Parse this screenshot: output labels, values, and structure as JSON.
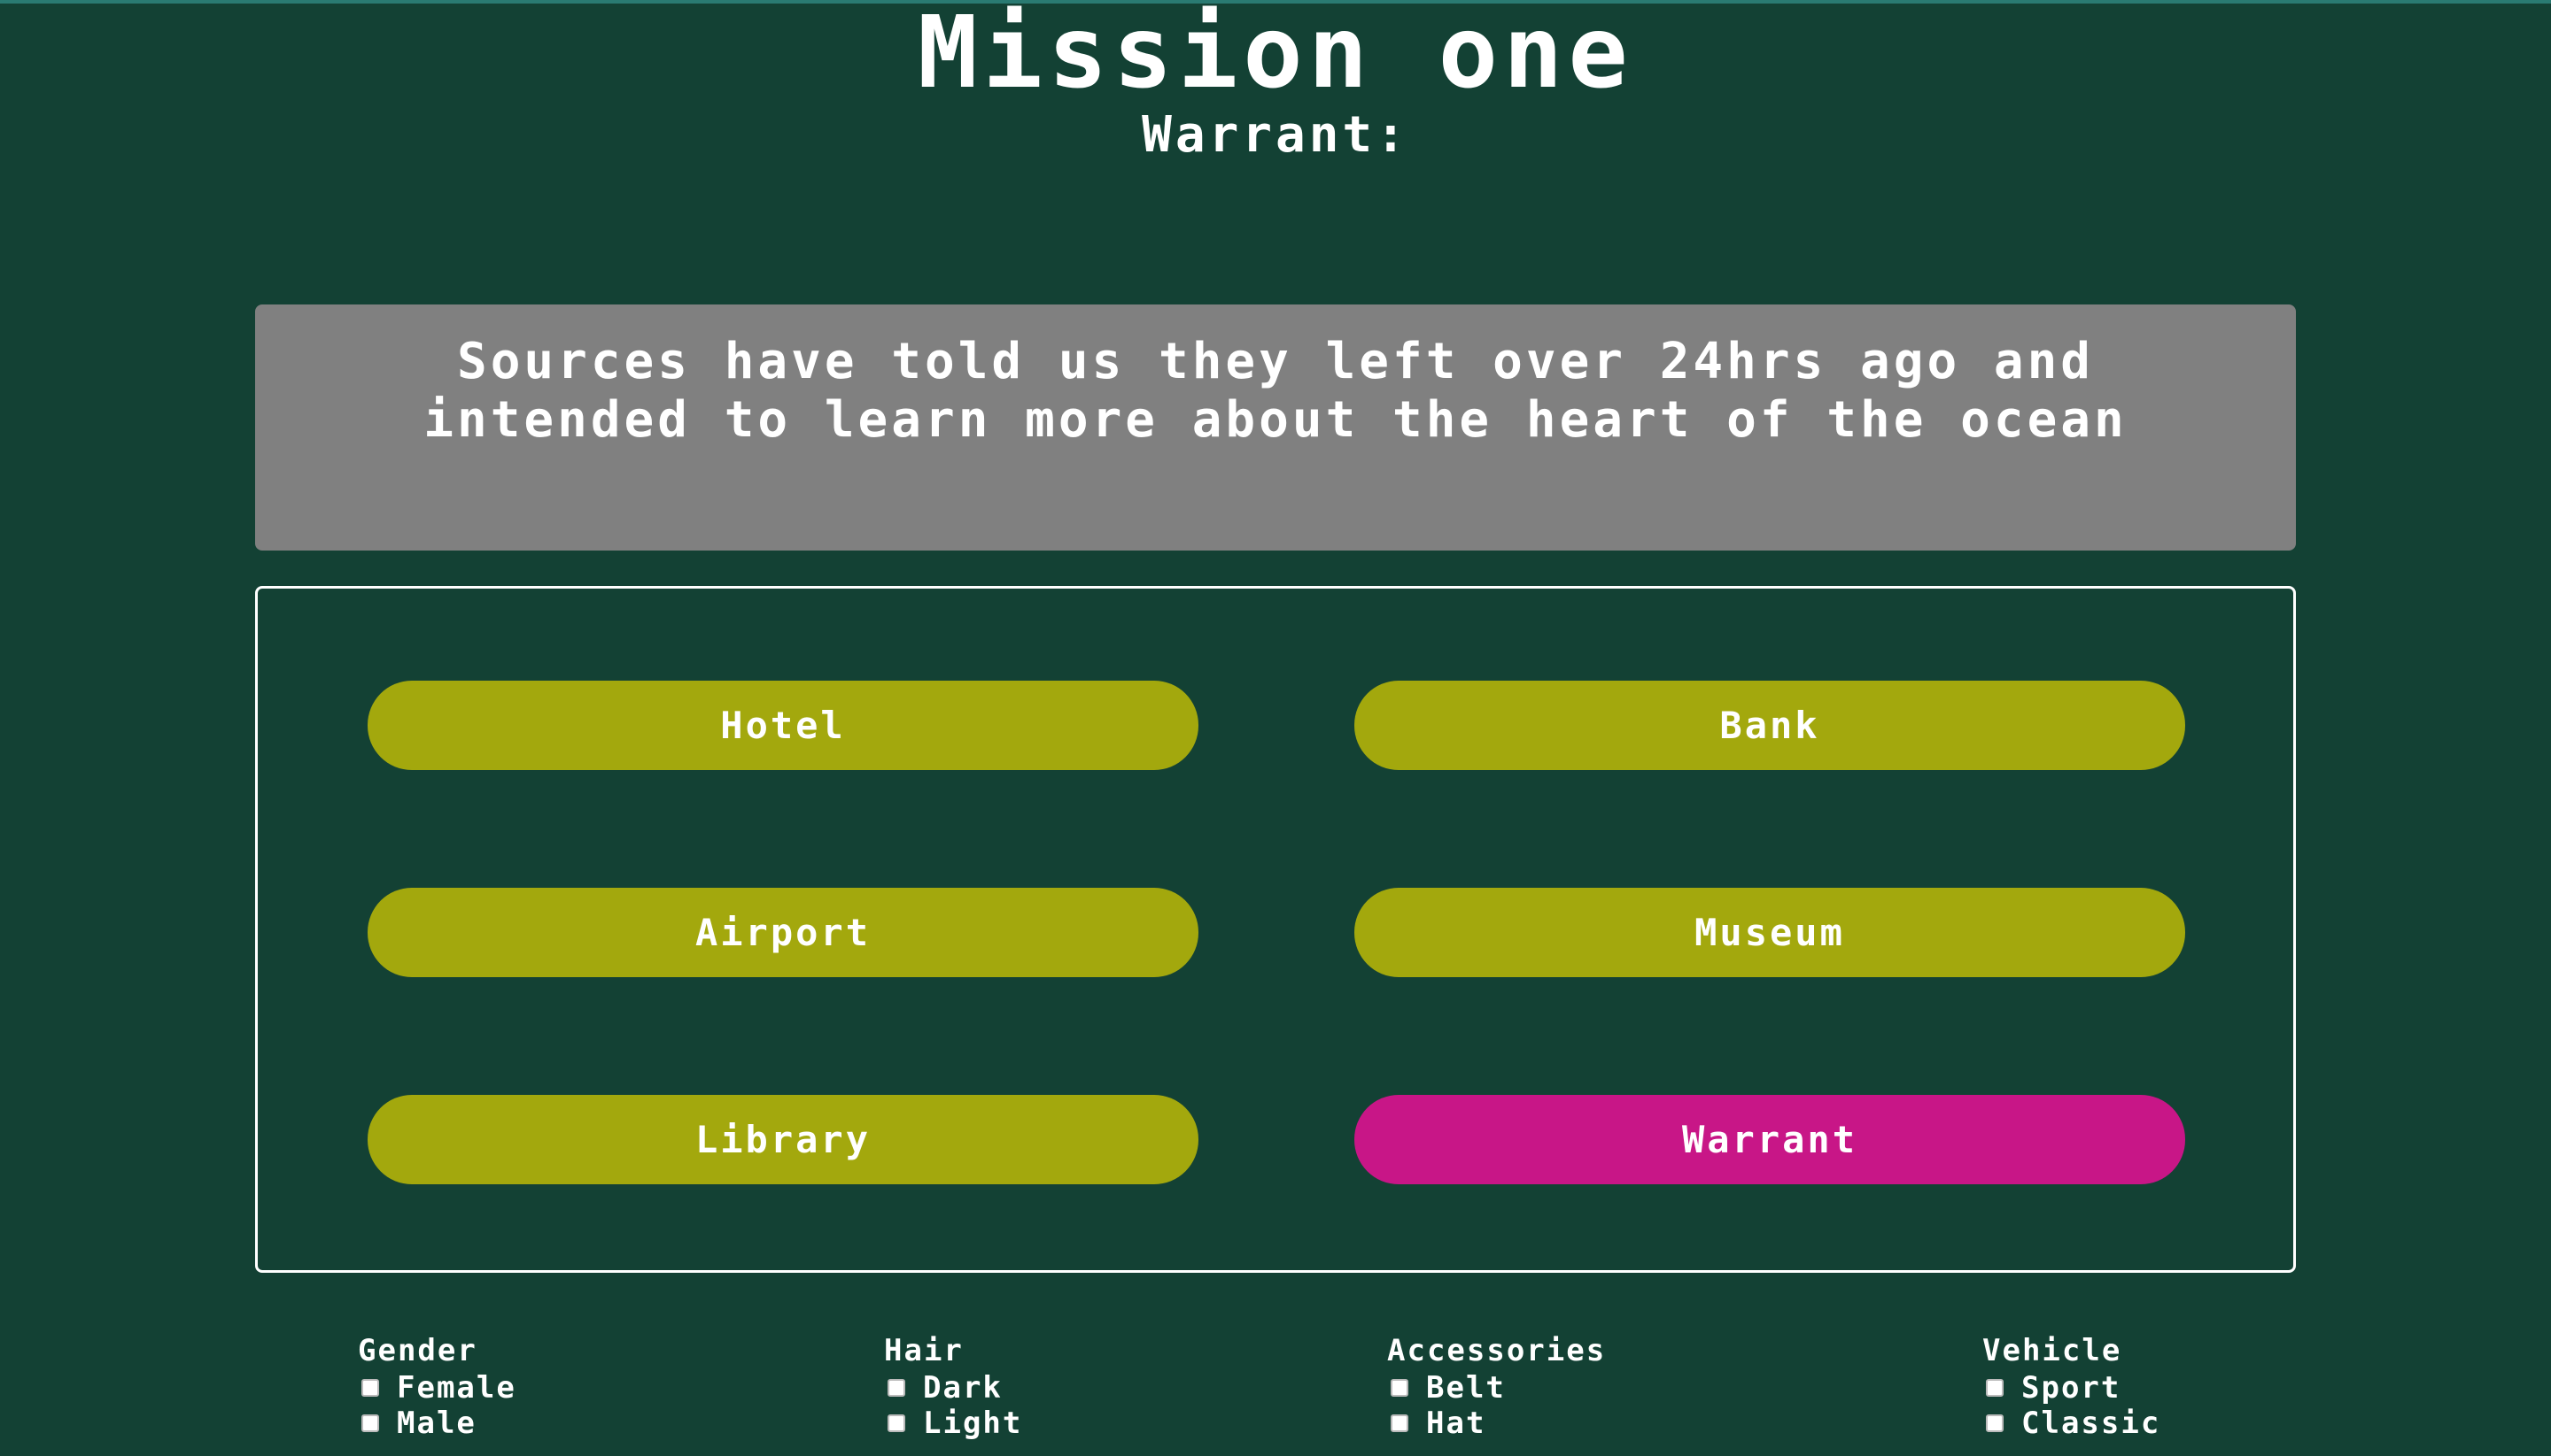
{
  "header": {
    "title": "Mission one",
    "subtitle": "Warrant:"
  },
  "clue": {
    "text": "Sources have told us they left over 24hrs ago and intended to learn more about the heart of the ocean"
  },
  "locations": {
    "hotel": "Hotel",
    "bank": "Bank",
    "airport": "Airport",
    "museum": "Museum",
    "library": "Library",
    "warrant": "Warrant"
  },
  "colors": {
    "background": "#134134",
    "clue_box": "#808080",
    "location_button": "#a3a80d",
    "warrant_button": "#c81687"
  },
  "filters": {
    "gender": {
      "title": "Gender",
      "options": [
        "Female",
        "Male"
      ]
    },
    "hair": {
      "title": "Hair",
      "options": [
        "Dark",
        "Light"
      ]
    },
    "accessories": {
      "title": "Accessories",
      "options": [
        "Belt",
        "Hat"
      ]
    },
    "vehicle": {
      "title": "Vehicle",
      "options": [
        "Sport",
        "Classic"
      ]
    }
  }
}
